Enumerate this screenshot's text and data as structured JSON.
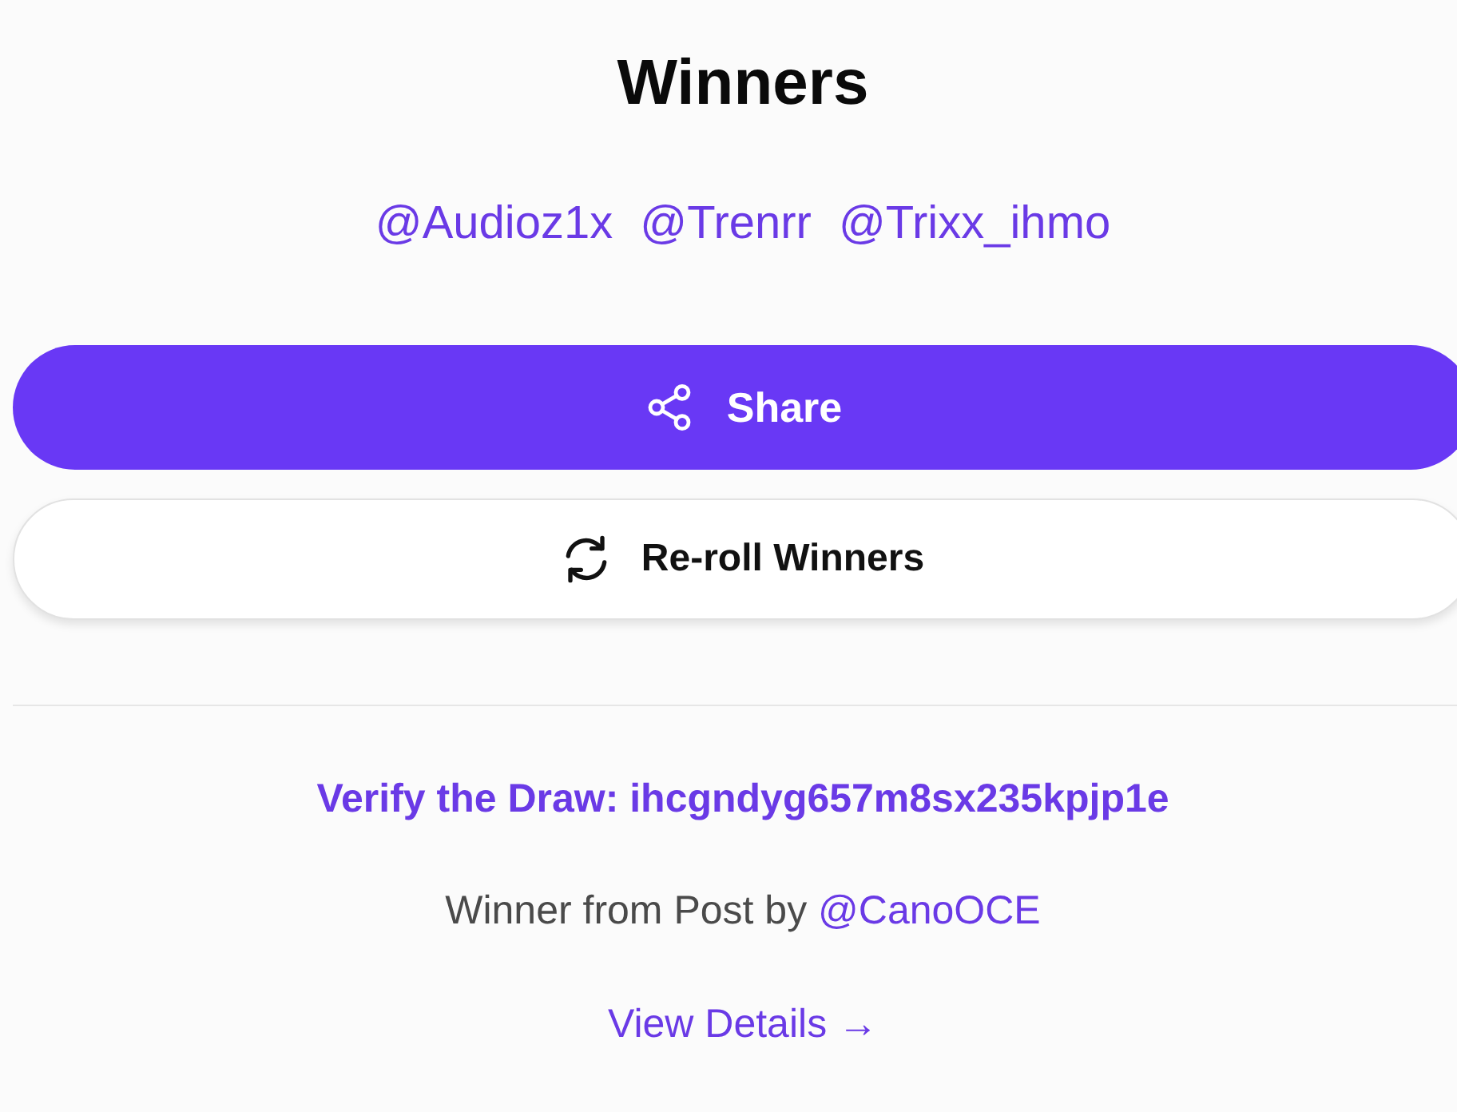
{
  "title": "Winners",
  "winners": [
    "@Audioz1x",
    "@Trenrr",
    "@Trixx_ihmo"
  ],
  "actions": [
    {
      "kind": "primary",
      "label": "Share"
    },
    {
      "kind": "secondary",
      "label": "Re-roll Winners"
    }
  ],
  "verify": {
    "label": "Verify the Draw: ihcgndyg657m8sx235kpjp1e"
  },
  "source": {
    "text": "Winner from Post by",
    "author": "@CanoOCE"
  },
  "details_link": "View Details →"
}
